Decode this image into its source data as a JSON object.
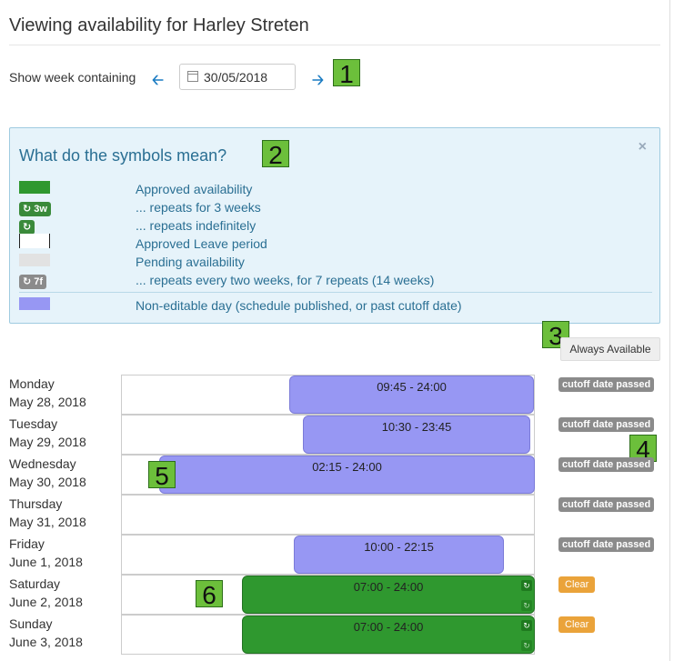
{
  "page": {
    "title": "Viewing availability for Harley Streten"
  },
  "week": {
    "label": "Show week containing",
    "date": "30/05/2018"
  },
  "callouts": [
    "1",
    "2",
    "3",
    "4",
    "5",
    "6"
  ],
  "legend": {
    "title": "What do the symbols mean?",
    "close": "×",
    "items": [
      {
        "chip": "",
        "text": "Approved availability"
      },
      {
        "chip": "3w",
        "text": "... repeats for 3 weeks"
      },
      {
        "chip": "",
        "text": "... repeats indefinitely"
      },
      {
        "chip": "",
        "text": "Approved Leave period"
      },
      {
        "chip": "",
        "text": "Pending availability"
      },
      {
        "chip": "7f",
        "text": "... repeats every two weeks, for 7 repeats (14 weeks)"
      },
      {
        "chip": "",
        "text": "Non-editable day (schedule published, or past cutoff date)"
      }
    ],
    "repeat_glyph": "↻",
    "colors": {
      "approved": "#2f982f",
      "pending": "#e2e2e2",
      "non_editable": "#9797f3"
    }
  },
  "always_available_label": "Always Available",
  "days": [
    {
      "name": "Monday",
      "date": "May 28, 2018",
      "time": "09:45 - 24:00",
      "status": "cutoff date passed"
    },
    {
      "name": "Tuesday",
      "date": "May 29, 2018",
      "time": "10:30 - 23:45",
      "status": "cutoff date passed"
    },
    {
      "name": "Wednesday",
      "date": "May 30, 2018",
      "time": "02:15 - 24:00",
      "status": "cutoff date passed"
    },
    {
      "name": "Thursday",
      "date": "May 31, 2018",
      "time": "",
      "status": "cutoff date passed"
    },
    {
      "name": "Friday",
      "date": "June 1, 2018",
      "time": "10:00 - 22:15",
      "status": "cutoff date passed"
    },
    {
      "name": "Saturday",
      "date": "June 2, 2018",
      "time": "07:00 - 24:00",
      "status": "Clear"
    },
    {
      "name": "Sunday",
      "date": "June 3, 2018",
      "time": "07:00 - 24:00",
      "status": "Clear"
    }
  ]
}
